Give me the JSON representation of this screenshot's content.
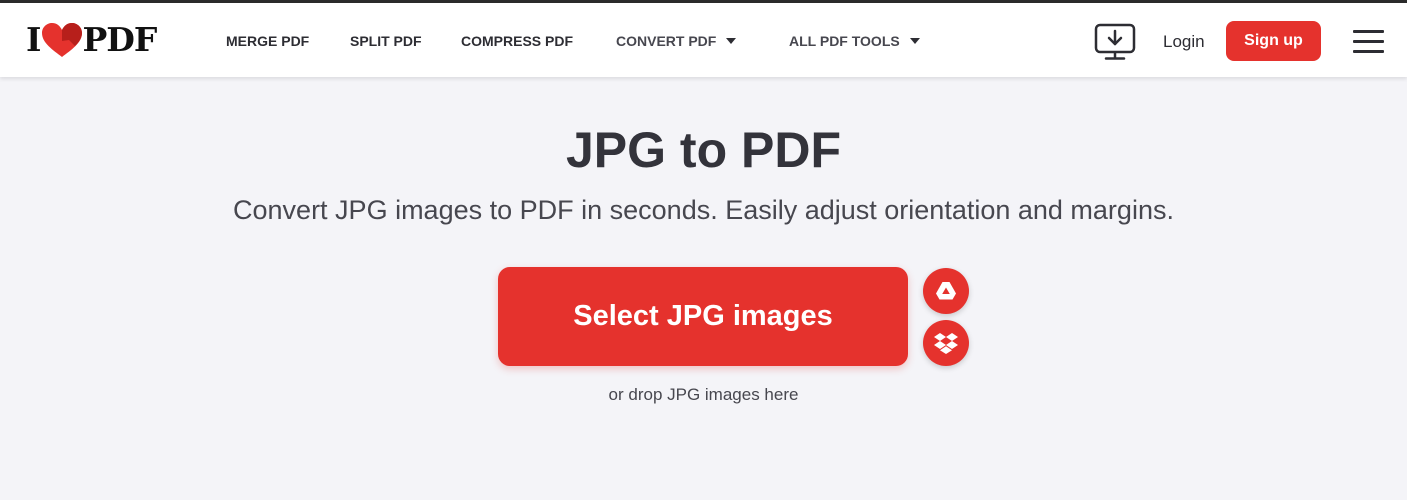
{
  "logo": {
    "prefix": "I",
    "suffix": "PDF",
    "heart_icon": "heart-icon"
  },
  "nav": {
    "items": [
      {
        "label": "MERGE PDF"
      },
      {
        "label": "SPLIT PDF"
      },
      {
        "label": "COMPRESS PDF"
      },
      {
        "label": "CONVERT PDF",
        "dropdown": true
      },
      {
        "label": "ALL PDF TOOLS",
        "dropdown": true
      }
    ]
  },
  "header_actions": {
    "desktop_icon": "desktop-download-icon",
    "login_label": "Login",
    "signup_label": "Sign up",
    "menu_icon": "hamburger-menu-icon"
  },
  "main": {
    "title": "JPG to PDF",
    "subtitle": "Convert JPG images to PDF in seconds. Easily adjust orientation and margins.",
    "select_button_label": "Select JPG images",
    "drop_hint": "or drop JPG images here",
    "cloud_sources": [
      "google-drive-icon",
      "dropbox-icon"
    ]
  },
  "colors": {
    "brand_red": "#e5322d",
    "background": "#f4f4f8",
    "header_bg": "#ffffff",
    "text_dark": "#33333b"
  }
}
